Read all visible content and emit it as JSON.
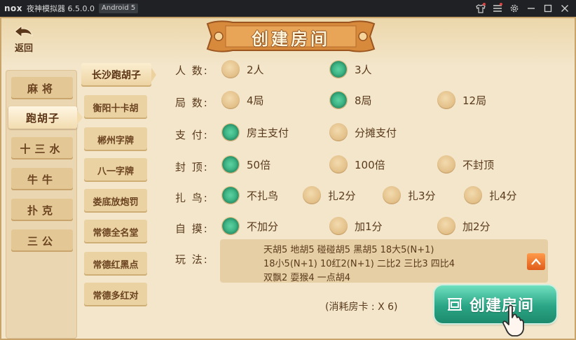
{
  "emulator": {
    "logo": "nox",
    "title": "夜神模拟器 6.5.0.0",
    "android_badge": "Android 5"
  },
  "header": {
    "back_label": "返回",
    "title": "创建房间"
  },
  "categories": [
    {
      "label": "麻将",
      "active": false
    },
    {
      "label": "跑胡子",
      "active": true
    },
    {
      "label": "十三水",
      "active": false
    },
    {
      "label": "牛牛",
      "active": false
    },
    {
      "label": "扑克",
      "active": false
    },
    {
      "label": "三公",
      "active": false
    }
  ],
  "variants": [
    {
      "label": "长沙跑胡子",
      "active": true
    },
    {
      "label": "衡阳十卡胡",
      "active": false
    },
    {
      "label": "郴州字牌",
      "active": false
    },
    {
      "label": "八一字牌",
      "active": false
    },
    {
      "label": "娄底放炮罚",
      "active": false
    },
    {
      "label": "常德全名堂",
      "active": false
    },
    {
      "label": "常德红黑点",
      "active": false
    },
    {
      "label": "常德多红对",
      "active": false
    }
  ],
  "options": {
    "players": {
      "label": "人 数:",
      "choices": [
        "2人",
        "3人"
      ],
      "selected": "3人"
    },
    "rounds": {
      "label": "局 数:",
      "choices": [
        "4局",
        "8局",
        "12局"
      ],
      "selected": "8局"
    },
    "payment": {
      "label": "支 付:",
      "choices": [
        "房主支付",
        "分摊支付"
      ],
      "selected": "房主支付"
    },
    "cap": {
      "label": "封 顶:",
      "choices": [
        "50倍",
        "100倍",
        "不封顶"
      ],
      "selected": "50倍"
    },
    "bird": {
      "label": "扎 鸟:",
      "choices": [
        "不扎鸟",
        "扎2分",
        "扎3分",
        "扎4分"
      ],
      "selected": "不扎鸟"
    },
    "self_draw": {
      "label": "自 摸:",
      "choices": [
        "不加分",
        "加1分",
        "加2分"
      ],
      "selected": "不加分"
    }
  },
  "rules": {
    "label": "玩 法:",
    "lines": [
      "天胡5  地胡5  碰碰胡5  黑胡5  18大5(N+1)",
      "18小5(N+1)  10红2(N+1)  二比2  三比3  四比4",
      "双飘2  耍猴4  一点胡4"
    ]
  },
  "footer": {
    "cost": "(消耗房卡 : X 6)",
    "create_button": "创建房间"
  },
  "colors": {
    "background": "#f3e6cb",
    "accent_green": "#2aa585",
    "text_brown": "#5a3a1c",
    "up_button": "#e05c1a"
  }
}
